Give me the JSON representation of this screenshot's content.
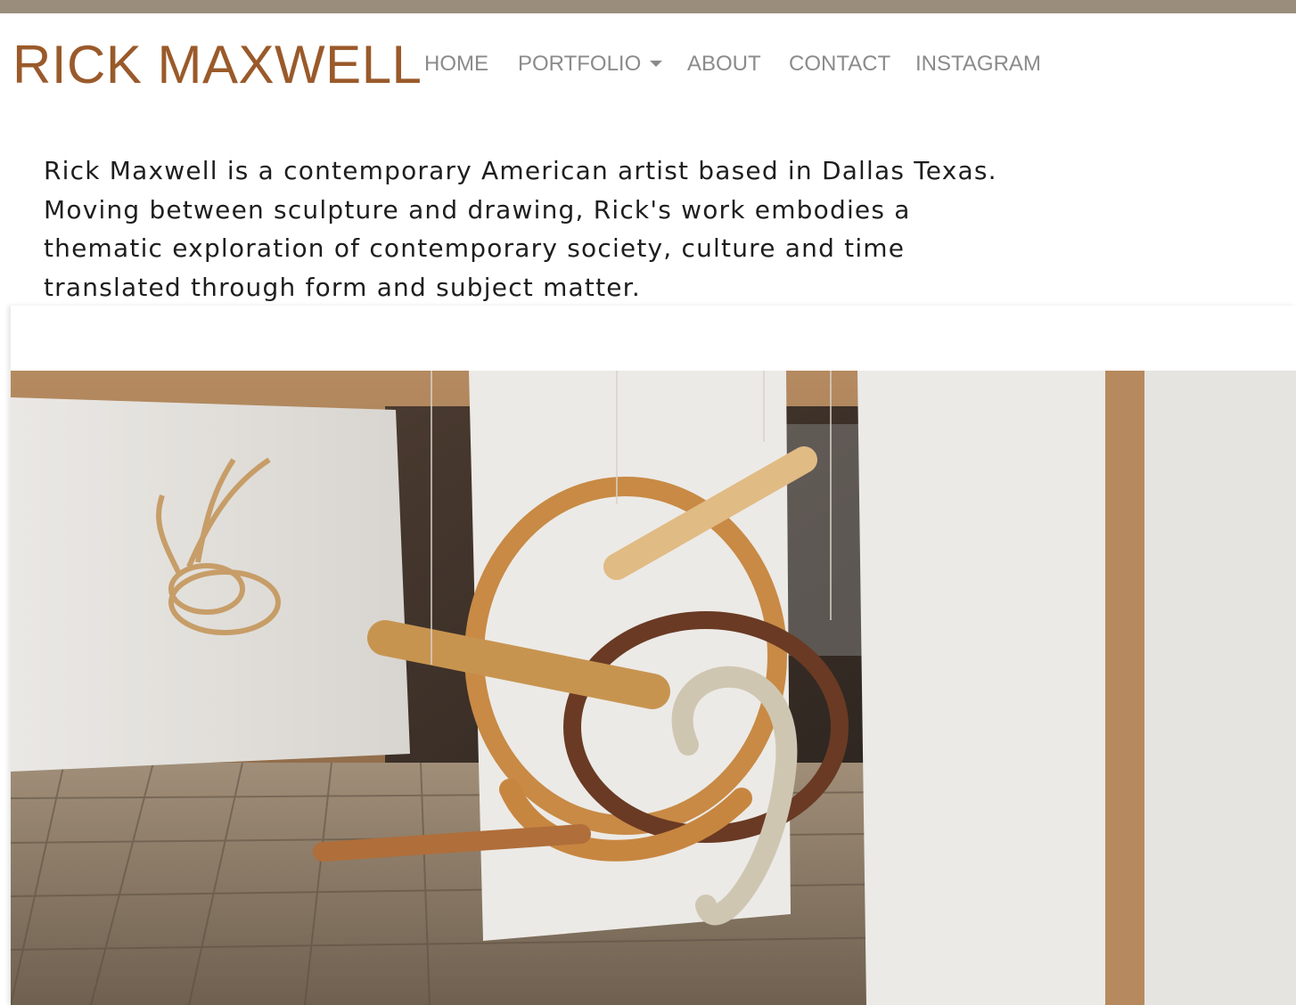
{
  "site": {
    "brand": "RICK MAXWELL"
  },
  "nav": {
    "items": [
      {
        "label": "HOME"
      },
      {
        "label": "PORTFOLIO"
      },
      {
        "label": "ABOUT"
      },
      {
        "label": "CONTACT"
      },
      {
        "label": "INSTAGRAM"
      }
    ]
  },
  "intro": {
    "lines": [
      "Rick Maxwell is a contemporary American artist based in Dallas Texas.",
      "Moving between sculpture and drawing, Rick's work embodies a",
      "thematic exploration of contemporary society, culture and time",
      "translated through form and subject matter."
    ]
  },
  "colors": {
    "topbar": "#9a8d7b",
    "brand": "#9a5a2a",
    "nav_text": "#8b8b8b",
    "body_text": "#1e1e1e"
  },
  "icons": {
    "portfolio_dropdown": "caret-down-icon"
  }
}
